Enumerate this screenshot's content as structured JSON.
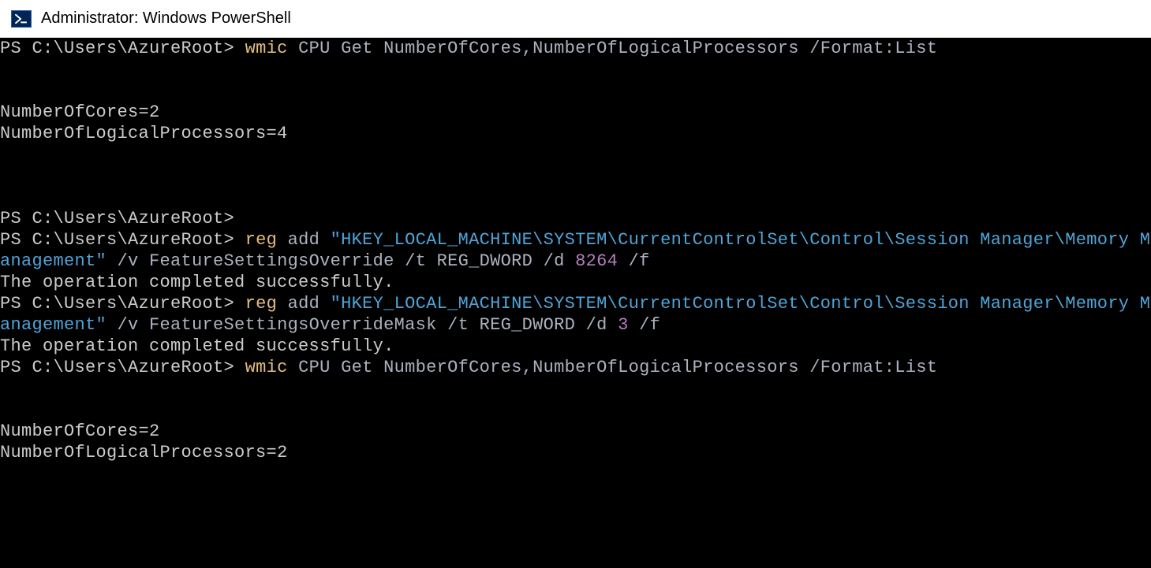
{
  "window": {
    "title": "Administrator: Windows PowerShell"
  },
  "session": {
    "prompt": "PS C:\\Users\\AzureRoot>",
    "cmd1_wmic": "wmic",
    "cmd1_rest": " CPU Get NumberOfCores,NumberOfLogicalProcessors /Format:List",
    "out1_cores": "NumberOfCores=2",
    "out1_logical": "NumberOfLogicalProcessors=4",
    "cmd2_reg": "reg",
    "cmd2_add": " add ",
    "cmd2_path": "\"HKEY_LOCAL_MACHINE\\SYSTEM\\CurrentControlSet\\Control\\Session Manager\\Memory Management\"",
    "cmd2_flags1": " /v FeatureSettingsOverride /t REG_DWORD /d ",
    "cmd2_val": "8264",
    "cmd2_flags2": " /f",
    "out2_success": "The operation completed successfully.",
    "cmd3_reg": "reg",
    "cmd3_add": " add ",
    "cmd3_path": "\"HKEY_LOCAL_MACHINE\\SYSTEM\\CurrentControlSet\\Control\\Session Manager\\Memory Management\"",
    "cmd3_flags1": " /v FeatureSettingsOverrideMask /t REG_DWORD /d ",
    "cmd3_val": "3",
    "cmd3_flags2": " /f",
    "out3_success": "The operation completed successfully.",
    "cmd4_wmic": "wmic",
    "cmd4_rest": " CPU Get NumberOfCores,NumberOfLogicalProcessors /Format:List",
    "out4_cores": "NumberOfCores=2",
    "out4_logical": "NumberOfLogicalProcessors=2"
  }
}
